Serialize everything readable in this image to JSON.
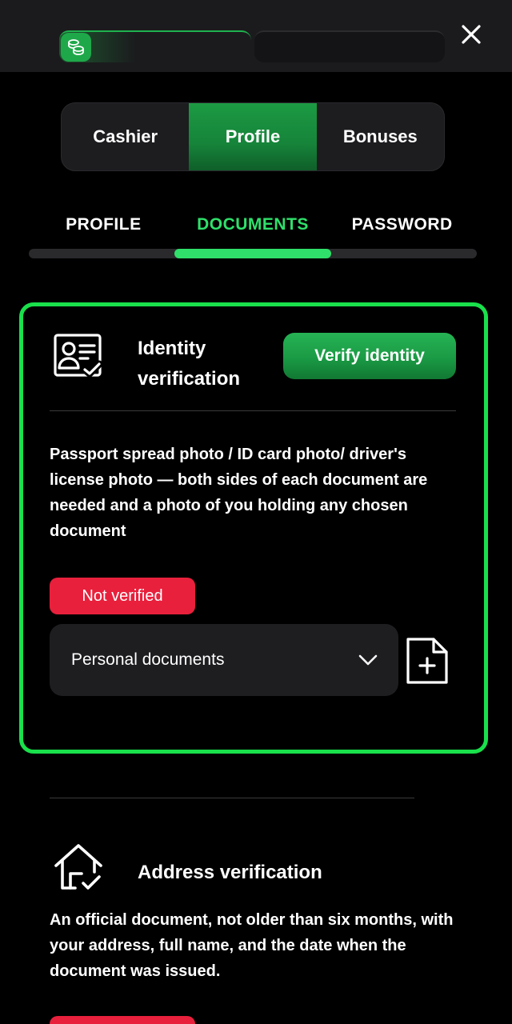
{
  "header": {
    "wallet_icon": "coins-icon",
    "close_icon": "close-icon"
  },
  "main_tabs": [
    {
      "label": "Cashier",
      "active": false
    },
    {
      "label": "Profile",
      "active": true
    },
    {
      "label": "Bonuses",
      "active": false
    }
  ],
  "sub_tabs": [
    {
      "label": "PROFILE",
      "active": false
    },
    {
      "label": "DOCUMENTS",
      "active": true
    },
    {
      "label": "PASSWORD",
      "active": false
    }
  ],
  "identity": {
    "icon": "id-card-check-icon",
    "title": "Identity verification",
    "verify_button": "Verify identity",
    "description": "Passport spread photo / ID card photo/ driver's license photo — both sides of each document are needed and a photo of you holding any chosen document",
    "status": "Not verified",
    "document_select": "Personal documents",
    "upload_icon": "file-plus-icon"
  },
  "address": {
    "icon": "home-check-icon",
    "title": "Address verification",
    "description": "An official document, not older than six months, with your address, full name, and the date when the document was issued."
  },
  "colors": {
    "accent": "#2fe06a",
    "card_border": "#19e04b",
    "button_green": "#1a9a44",
    "error_red": "#e8203c",
    "background": "#000000",
    "surface": "#1e1e21"
  }
}
